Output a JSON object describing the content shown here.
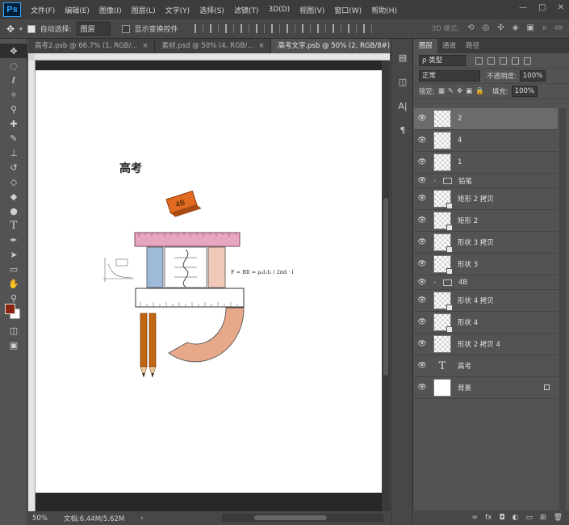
{
  "app": {
    "logo": "Ps"
  },
  "menu": [
    "文件(F)",
    "编辑(E)",
    "图像(I)",
    "图层(L)",
    "文字(Y)",
    "选择(S)",
    "滤镜(T)",
    "3D(D)",
    "视图(V)",
    "窗口(W)",
    "帮助(H)"
  ],
  "window_controls": {
    "minimize": "—",
    "maximize": "□",
    "close": "✕"
  },
  "options": {
    "auto_select_label": "自动选择:",
    "auto_select_value": "图层",
    "show_transform_label": "显示变换控件",
    "mode_3d_label": "3D 模式:"
  },
  "tabs": [
    {
      "label": "高考2.psb @ 66.7% (1, RGB/...",
      "close": "×"
    },
    {
      "label": "素材.psd @ 50% (4, RGB/...",
      "close": "×"
    },
    {
      "label": "高考文字.psb @ 50% (2, RGB/8#) *",
      "close": "×"
    }
  ],
  "canvas_art": {
    "title": "高考",
    "eraser_label": "4B",
    "formula": "F = BIl = μ₀I₁I₂ / 2πd · l"
  },
  "status": {
    "zoom": "50%",
    "doc": "文档:6.44M/5.62M",
    "arrow": "›"
  },
  "panel": {
    "tabs": [
      "图层",
      "通道",
      "路径"
    ],
    "filter_label": "ρ 类型",
    "blend_mode": "正常",
    "opacity_label": "不透明度:",
    "opacity_value": "100%",
    "lock_label": "锁定:",
    "fill_label": "填充:",
    "fill_value": "100%",
    "bottom_icons": [
      "∞",
      "fx",
      "◘",
      "◐",
      "▭",
      "⊞",
      "🗑"
    ]
  },
  "layers": [
    {
      "name": "2",
      "kind": "pixel",
      "selected": true
    },
    {
      "name": "4",
      "kind": "pixel"
    },
    {
      "name": "1",
      "kind": "pixel"
    },
    {
      "name": "铅笔",
      "kind": "group"
    },
    {
      "name": "矩形 2 拷贝",
      "kind": "smart"
    },
    {
      "name": "矩形 2",
      "kind": "smart"
    },
    {
      "name": "形状 3 拷贝",
      "kind": "smart"
    },
    {
      "name": "形状 3",
      "kind": "smart"
    },
    {
      "name": "4B",
      "kind": "group"
    },
    {
      "name": "形状 4 拷贝",
      "kind": "smart"
    },
    {
      "name": "形状 4",
      "kind": "smart"
    },
    {
      "name": "形状 2 拷贝 4",
      "kind": "smart"
    },
    {
      "name": "高考",
      "kind": "text"
    },
    {
      "name": "背景",
      "kind": "background"
    }
  ],
  "colors": {
    "foreground": "#8b2512",
    "background": "#ffffff",
    "accent": "#31a8ff"
  }
}
